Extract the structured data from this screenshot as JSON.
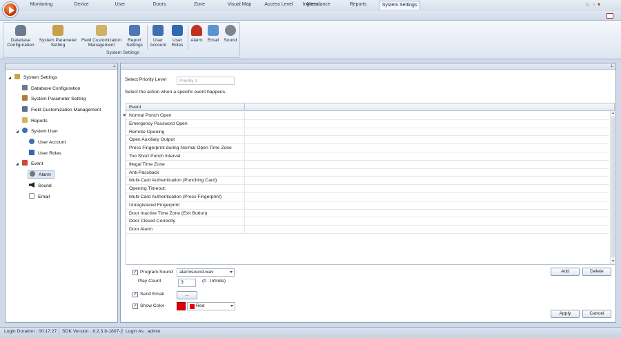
{
  "app": {
    "title": "Ingress"
  },
  "tabs": [
    {
      "label": "Monitoring"
    },
    {
      "label": "Device"
    },
    {
      "label": "User"
    },
    {
      "label": "Doors"
    },
    {
      "label": "Zone"
    },
    {
      "label": "Visual Map"
    },
    {
      "label": "Access Level"
    },
    {
      "label": "Attendance"
    },
    {
      "label": "Reports"
    },
    {
      "label": "System Settings"
    }
  ],
  "active_tab": "System Settings",
  "ribbon": {
    "group_label": "System Settings",
    "buttons": [
      {
        "line1": "Database",
        "line2": "Configuration",
        "icon": "database-icon",
        "color": "#6b7a8e"
      },
      {
        "line1": "System Parameter",
        "line2": "Setting",
        "icon": "parameter-icon",
        "color": "#c9a04a"
      },
      {
        "line1": "Field Customization",
        "line2": "Management",
        "icon": "field-icon",
        "color": "#d0b16a"
      },
      {
        "line1": "Report",
        "line2": "Settings",
        "icon": "report-icon",
        "color": "#4c78b5"
      },
      {
        "line1": "User",
        "line2": "Account",
        "icon": "user-account-icon",
        "color": "#3f6fb0"
      },
      {
        "line1": "User",
        "line2": "Roles",
        "icon": "user-roles-icon",
        "color": "#2f67b1"
      },
      {
        "line1": "Alarm",
        "line2": "",
        "icon": "alarm-icon",
        "color": "#c1311f"
      },
      {
        "line1": "Email",
        "line2": "",
        "icon": "email-icon",
        "color": "#5a94cf"
      },
      {
        "line1": "Sound",
        "line2": "",
        "icon": "sound-icon",
        "color": "#7d8591"
      }
    ]
  },
  "tree": {
    "nodes": [
      {
        "label": "System Settings",
        "level": 0,
        "expander": "◢",
        "icon": "settings-folder-icon",
        "color": "#c8a452"
      },
      {
        "label": "Database Configuration",
        "level": 1,
        "icon": "database-icon",
        "color": "#6b7a8e"
      },
      {
        "label": "System Parameter Setting",
        "level": 1,
        "icon": "parameter-icon",
        "color": "#b07a3a"
      },
      {
        "label": "Field Customization Management",
        "level": 1,
        "icon": "field-icon",
        "color": "#5a6f8e"
      },
      {
        "label": "Reports",
        "level": 1,
        "icon": "report-icon",
        "color": "#d6b45e"
      },
      {
        "label": "System User",
        "level": 1,
        "expander": "◢",
        "icon": "user-group-icon",
        "color": "#3f6fb0"
      },
      {
        "label": "User Account",
        "level": 2,
        "icon": "user-account-icon",
        "color": "#3f6fb0"
      },
      {
        "label": "User Roles",
        "level": 2,
        "icon": "user-roles-icon",
        "color": "#2f67b1"
      },
      {
        "label": "Event",
        "level": 1,
        "expander": "◢",
        "icon": "calendar-icon",
        "color": "#c84b3a"
      },
      {
        "label": "Alarm",
        "level": 2,
        "icon": "alarm-icon",
        "color": "#6d7684",
        "selected": true
      },
      {
        "label": "Sound",
        "level": 2,
        "icon": "speaker-icon",
        "color": "#222"
      },
      {
        "label": "Email",
        "level": 2,
        "icon": "email-icon",
        "color": "#8892a0"
      }
    ]
  },
  "main": {
    "priority_label": "Select Priority Level",
    "priority_value": "Priority 1",
    "instruction": "Select the action when a specific event happens.",
    "grid_header": "Event",
    "events": [
      "Normal Punch Open",
      "Emergency Password Open",
      "Remote Opening",
      "Open Auxiliary Output",
      "Press Fingerprint during Normal Open Time Zone",
      "Too Short Punch Interval",
      "Illegal Time Zone",
      "Anti-Passback",
      "Multi-Card Authentication (Punching Card)",
      "Opening Timeout:",
      "Multi-Card Authentication (Press Fingerprint)",
      "Unregistered Fingerprint",
      "Door Inactive Time Zone (Exit Button)",
      "Door Closed Correctly",
      "Door Alarm"
    ],
    "program_sound": {
      "label": "Program Sound",
      "checked": "✓",
      "value": "alarmsound.wav"
    },
    "play_count": {
      "label": "Play Count",
      "value": "3",
      "hint": "(0 : Infinite)"
    },
    "send_email": {
      "label": "Send Email",
      "checked": "✓",
      "button": "..."
    },
    "show_color": {
      "label": "Show Color",
      "checked": "✓",
      "value": "Red",
      "color": "#e0000a"
    },
    "buttons": {
      "add": "Add",
      "delete": "Delete",
      "apply": "Apply",
      "cancel": "Cancel"
    }
  },
  "status": {
    "login_duration": "Login Duration : 00:17:27",
    "sdk_version": "SDK Version : 6.2.3.8-1807-2",
    "login_as": "Login As : admin"
  }
}
